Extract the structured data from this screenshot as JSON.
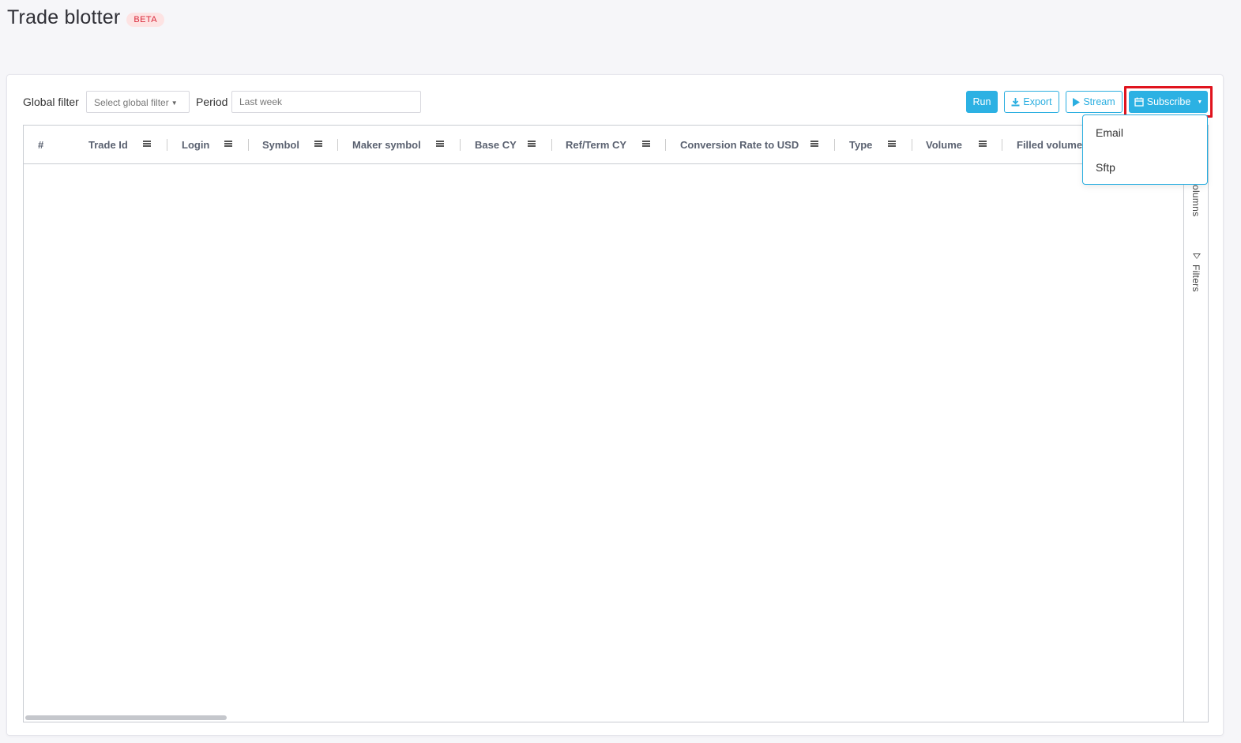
{
  "page": {
    "title": "Trade blotter",
    "badge": "BETA"
  },
  "toolbar": {
    "global_filter_label": "Global filter",
    "global_filter_placeholder": "Select global filter",
    "period_label": "Period",
    "period_placeholder": "Last week",
    "run_label": "Run",
    "export_label": "Export",
    "stream_label": "Stream",
    "subscribe_label": "Subscribe"
  },
  "grid": {
    "columns": [
      "#",
      "Trade Id",
      "Login",
      "Symbol",
      "Maker symbol",
      "Base CY",
      "Ref/Term CY",
      "Conversion Rate to USD",
      "Type",
      "Volume",
      "Filled volume"
    ],
    "rows": [],
    "side_tabs": {
      "columns": "Columns",
      "filters": "Filters"
    }
  },
  "subscribe_menu": {
    "items": [
      "Email",
      "Sftp"
    ]
  },
  "colors": {
    "accent": "#2cb1e3",
    "badge_text": "#d9283a",
    "badge_bg": "#fde3e3",
    "highlight": "#e0141e"
  }
}
